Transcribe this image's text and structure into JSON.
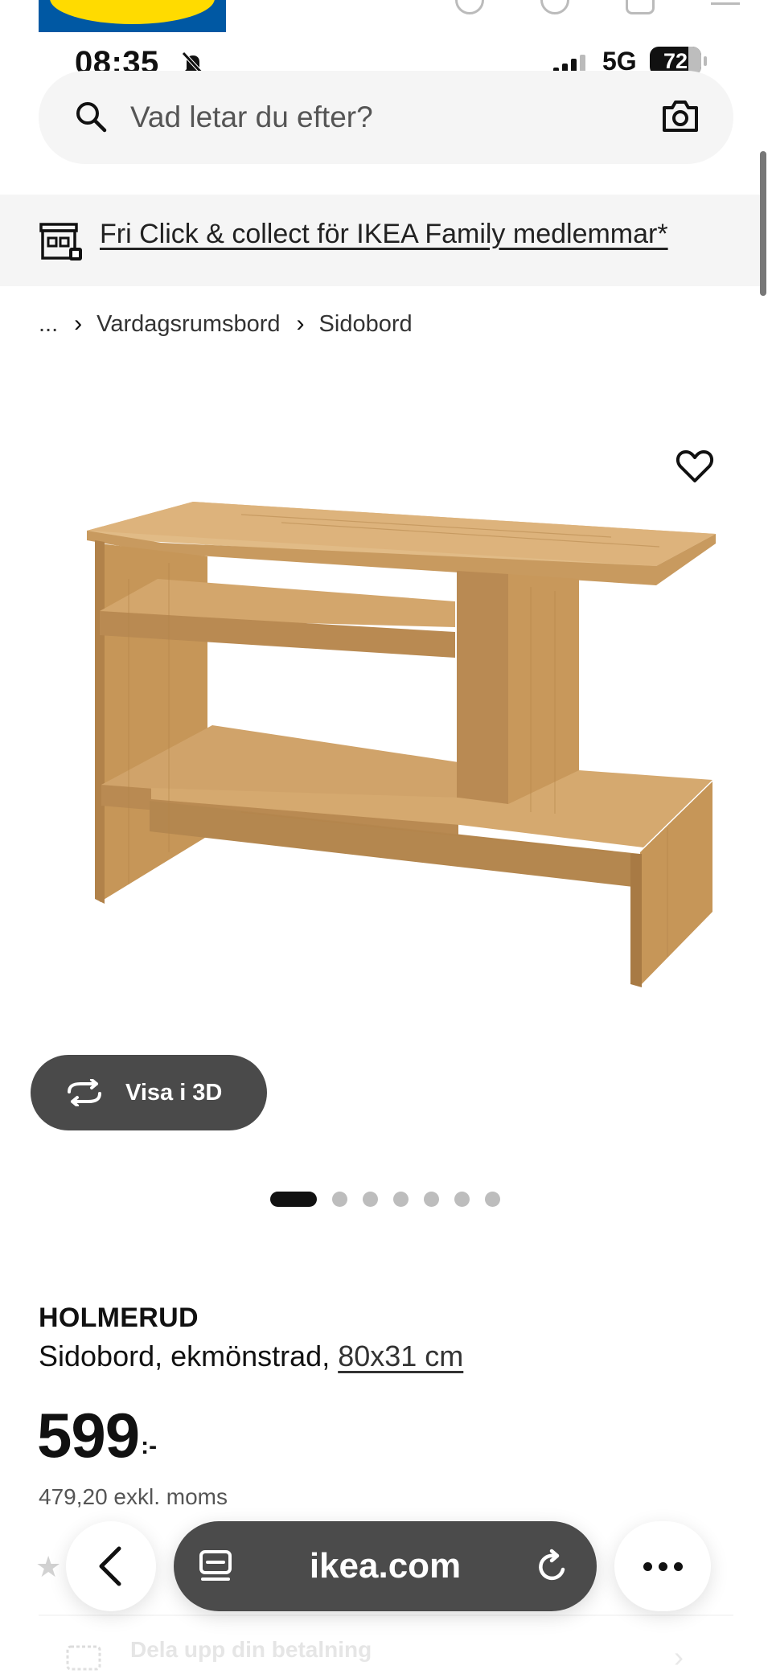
{
  "status_bar": {
    "time": "08:35",
    "network": "5G",
    "battery": "72"
  },
  "search": {
    "placeholder": "Vad letar du efter?"
  },
  "banner": {
    "text": "Fri Click & collect för IKEA Family medlemmar*"
  },
  "breadcrumb": {
    "items": [
      "...",
      "Vardagsrumsbord",
      "Sidobord"
    ]
  },
  "product": {
    "name": "HOLMERUD",
    "description": "Sidobord, ekmönstrad, ",
    "size": "80x31 cm",
    "price": "599",
    "price_suffix": ":-",
    "price_ex_vat": "479,20 exkl. moms",
    "image_icon": "side-table-illustration",
    "view_3d_label": "Visa i 3D",
    "carousel": {
      "total": 7,
      "active": 1
    }
  },
  "partial_payment": {
    "label": "Dela upp din betalning"
  },
  "browser": {
    "url": "ikea.com"
  },
  "colors": {
    "ikea_blue": "#0058a3",
    "ikea_yellow": "#ffdb00",
    "wood_light": "#d6ad75",
    "wood_mid": "#c4945a",
    "wood_dark": "#a97b42"
  }
}
